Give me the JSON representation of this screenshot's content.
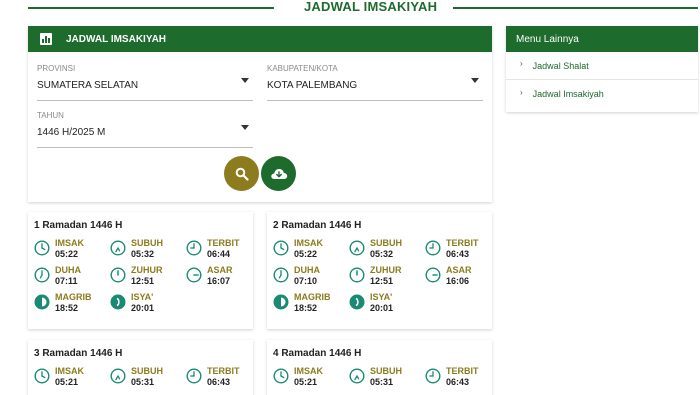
{
  "page_title": "JADWAL IMSAKIYAH",
  "form": {
    "header_title": "JADWAL IMSAKIYAH",
    "provinsi_label": "PROVINSI",
    "provinsi_value": "SUMATERA SELATAN",
    "kabupaten_label": "KABUPATEN/KOTA",
    "kabupaten_value": "KOTA PALEMBANG",
    "tahun_label": "TAHUN",
    "tahun_value": "1446 H/2025 M"
  },
  "sidebar": {
    "title": "Menu Lainnya",
    "items": [
      {
        "label": "Jadwal Shalat"
      },
      {
        "label": "Jadwal Imsakiyah"
      }
    ]
  },
  "colors": {
    "primary": "#1e6b2e",
    "accent": "#8c7c1e",
    "icon": "#1a8a74"
  },
  "days": [
    {
      "title": "1 Ramadan 1446 H",
      "times": [
        {
          "name": "IMSAK",
          "time": "05:22",
          "icon": "clock-icon"
        },
        {
          "name": "SUBUH",
          "time": "05:32",
          "icon": "subuh-icon"
        },
        {
          "name": "TERBIT",
          "time": "06:44",
          "icon": "terbit-icon"
        },
        {
          "name": "DUHA",
          "time": "07:11",
          "icon": "duha-icon"
        },
        {
          "name": "ZUHUR",
          "time": "12:51",
          "icon": "zuhur-icon"
        },
        {
          "name": "ASAR",
          "time": "16:07",
          "icon": "asar-icon"
        },
        {
          "name": "MAGRIB",
          "time": "18:52",
          "icon": "magrib-icon"
        },
        {
          "name": "ISYA'",
          "time": "20:01",
          "icon": "isya-icon"
        }
      ]
    },
    {
      "title": "2 Ramadan 1446 H",
      "times": [
        {
          "name": "IMSAK",
          "time": "05:22",
          "icon": "clock-icon"
        },
        {
          "name": "SUBUH",
          "time": "05:32",
          "icon": "subuh-icon"
        },
        {
          "name": "TERBIT",
          "time": "06:43",
          "icon": "terbit-icon"
        },
        {
          "name": "DUHA",
          "time": "07:10",
          "icon": "duha-icon"
        },
        {
          "name": "ZUHUR",
          "time": "12:51",
          "icon": "zuhur-icon"
        },
        {
          "name": "ASAR",
          "time": "16:06",
          "icon": "asar-icon"
        },
        {
          "name": "MAGRIB",
          "time": "18:52",
          "icon": "magrib-icon"
        },
        {
          "name": "ISYA'",
          "time": "20:01",
          "icon": "isya-icon"
        }
      ]
    },
    {
      "title": "3 Ramadan 1446 H",
      "times": [
        {
          "name": "IMSAK",
          "time": "05:21",
          "icon": "clock-icon"
        },
        {
          "name": "SUBUH",
          "time": "05:31",
          "icon": "subuh-icon"
        },
        {
          "name": "TERBIT",
          "time": "06:43",
          "icon": "terbit-icon"
        }
      ]
    },
    {
      "title": "4 Ramadan 1446 H",
      "times": [
        {
          "name": "IMSAK",
          "time": "05:21",
          "icon": "clock-icon"
        },
        {
          "name": "SUBUH",
          "time": "05:31",
          "icon": "subuh-icon"
        },
        {
          "name": "TERBIT",
          "time": "06:43",
          "icon": "terbit-icon"
        }
      ]
    }
  ]
}
